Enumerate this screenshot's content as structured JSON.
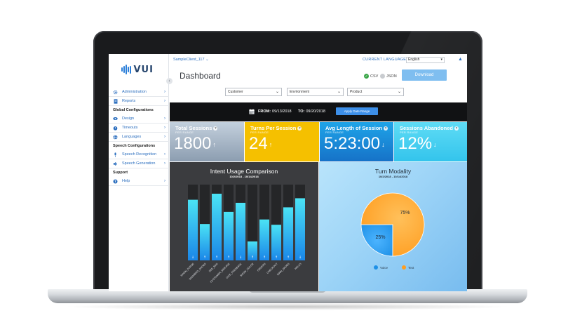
{
  "app": {
    "logo_text": "VUI"
  },
  "colors": {
    "brand_blue": "#2c6fbf",
    "kpi_gray": "#8c9db0",
    "kpi_yellow": "#f5c000",
    "kpi_blue": "#1672c8",
    "kpi_cyan": "#33c4ec",
    "pie_blue": "#1e90e6",
    "pie_orange": "#ff9d20"
  },
  "sidebar": {
    "items": [
      {
        "label": "Administration",
        "icon": "gear-icon"
      },
      {
        "label": "Reports",
        "icon": "document-icon"
      }
    ],
    "section_global": "Global Configurations",
    "global_items": [
      {
        "label": "Design",
        "icon": "eye-icon"
      },
      {
        "label": "Timeouts",
        "icon": "stopwatch-icon"
      },
      {
        "label": "Languages",
        "icon": "globe-icon"
      }
    ],
    "section_speech": "Speech Configurations",
    "speech_items": [
      {
        "label": "Speech Recognition",
        "icon": "microphone-icon"
      },
      {
        "label": "Speech Generation",
        "icon": "speaker-icon"
      }
    ],
    "section_support": "Support",
    "support_items": [
      {
        "label": "Help",
        "icon": "help-icon"
      }
    ]
  },
  "topbar": {
    "client": "SampleClient_117",
    "language_label": "CURRENT LANGUAGE",
    "language_value": "English"
  },
  "page": {
    "title": "Dashboard"
  },
  "export": {
    "csv_label": "CSV",
    "json_label": "JSON",
    "csv_selected": true,
    "download_label": "Download"
  },
  "filters": {
    "customer": "Customer",
    "environment": "Environment",
    "product": "Product"
  },
  "date_range": {
    "from_label": "FROM:",
    "from_value": "09/13/2018",
    "to_label": "TO:",
    "to_value": "09/20/2018",
    "apply_label": "Apply Date Range"
  },
  "kpis": [
    {
      "title": "Total Sessions",
      "sub": "PER RANGE",
      "value": "1800",
      "arrow": "↑"
    },
    {
      "title": "Turns Per Session",
      "sub": "PER RANGE",
      "value": "24",
      "arrow": "↑"
    },
    {
      "title": "Avg Length of Session",
      "sub": "PER RANGE",
      "value": "5:23:00",
      "arrow": "↓"
    },
    {
      "title": "Sessions Abandoned",
      "sub": "PER RANGE",
      "value": "12%",
      "arrow": "↓"
    }
  ],
  "chart_data": [
    {
      "type": "bar",
      "title": "Intent Usage Comparison",
      "subtitle": "10/2/2018 - 10/14/2018",
      "categories": [
        "SHOW_PURSE",
        "WISHBIRD_SHOES",
        "SEE_BAG",
        "CUSTOMER_SERVICE",
        "GIVE_FEEDBACK",
        "SHOW_COLOR",
        "ORDERS",
        "CHECKOUT",
        "MAIN_SHOES",
        "HELLO"
      ],
      "values": [
        80,
        48,
        88,
        64,
        76,
        25,
        54,
        47,
        70,
        82
      ],
      "arrows": [
        "↓",
        "↑",
        "↑",
        "↑",
        "↓",
        "↑",
        "↑",
        "↑",
        "↑",
        "↓"
      ],
      "ylim": [
        0,
        100
      ]
    },
    {
      "type": "pie",
      "title": "Turn Modality",
      "subtitle": "10/2/2018 - 10/14/2018",
      "categories": [
        "Voice",
        "Text"
      ],
      "values": [
        25,
        75
      ],
      "labels": [
        "25%",
        "75%"
      ],
      "legend": "bottom"
    }
  ]
}
